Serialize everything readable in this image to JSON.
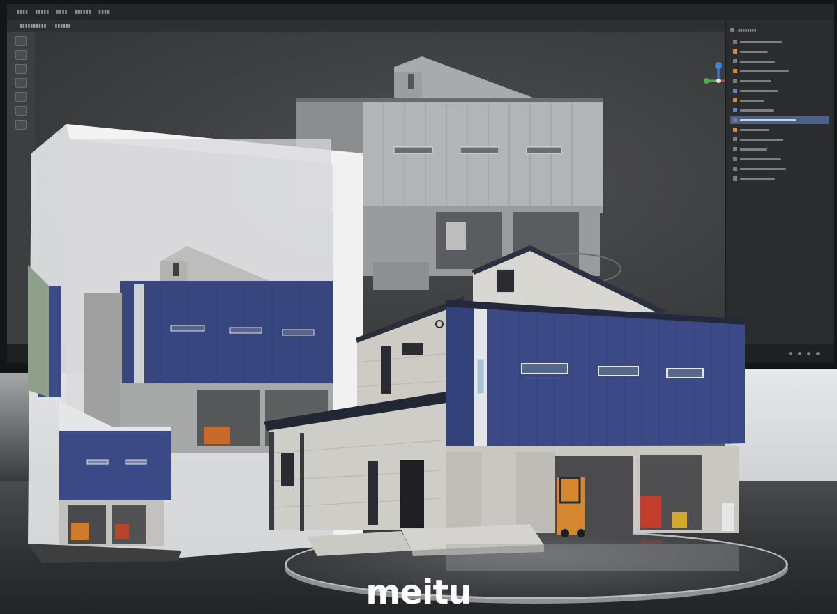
{
  "scene": {
    "description_colors": {
      "blue_cladding": "#3b4a86",
      "light_cladding": "#c9c7c0",
      "roof": "#2a2f3a",
      "forklift": "#d07a2a"
    },
    "watermark": "meitu"
  },
  "monitor": {
    "app_window": {
      "outliner_rows": 16,
      "selected_row_index": 9
    }
  }
}
